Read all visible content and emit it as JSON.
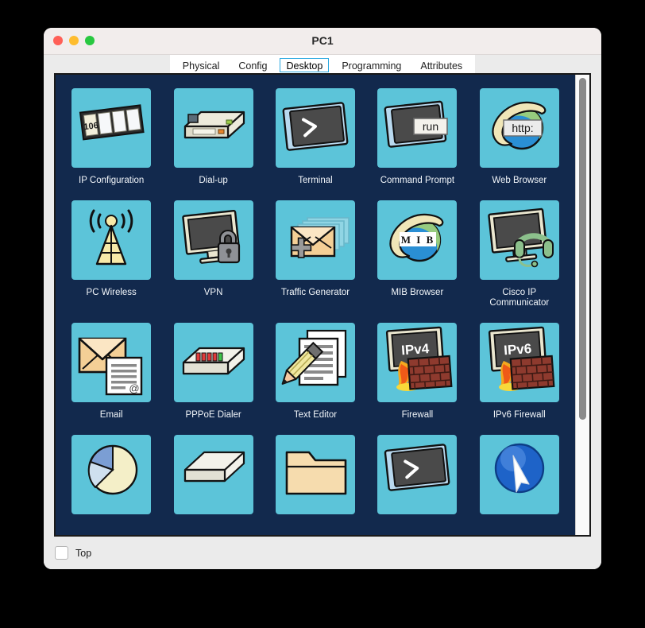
{
  "window": {
    "title": "PC1",
    "controls": [
      {
        "name": "close",
        "color": "#ff5f57"
      },
      {
        "name": "minimize",
        "color": "#febc2e"
      },
      {
        "name": "zoom",
        "color": "#28c840"
      }
    ]
  },
  "tabs": [
    {
      "label": "Physical",
      "active": false
    },
    {
      "label": "Config",
      "active": false
    },
    {
      "label": "Desktop",
      "active": true
    },
    {
      "label": "Programming",
      "active": false
    },
    {
      "label": "Attributes",
      "active": false
    }
  ],
  "desktop": {
    "background_color": "#12294d",
    "tile_color": "#5cc4d9",
    "items": [
      {
        "label": "IP Configuration",
        "icon": "ip-configuration-icon",
        "badge": "106"
      },
      {
        "label": "Dial-up",
        "icon": "dial-up-icon",
        "badge": ""
      },
      {
        "label": "Terminal",
        "icon": "terminal-icon",
        "badge": ">"
      },
      {
        "label": "Command Prompt",
        "icon": "command-prompt-icon",
        "badge": "run"
      },
      {
        "label": "Web Browser",
        "icon": "web-browser-icon",
        "badge": "http:"
      },
      {
        "label": "PC Wireless",
        "icon": "pc-wireless-icon",
        "badge": ""
      },
      {
        "label": "VPN",
        "icon": "vpn-icon",
        "badge": ""
      },
      {
        "label": "Traffic Generator",
        "icon": "traffic-generator-icon",
        "badge": ""
      },
      {
        "label": "MIB Browser",
        "icon": "mib-browser-icon",
        "badge": "M I B"
      },
      {
        "label": "Cisco IP Communicator",
        "icon": "cisco-ip-communicator-icon",
        "badge": ""
      },
      {
        "label": "Email",
        "icon": "email-icon",
        "badge": "@"
      },
      {
        "label": "PPPoE Dialer",
        "icon": "pppoe-dialer-icon",
        "badge": ""
      },
      {
        "label": "Text Editor",
        "icon": "text-editor-icon",
        "badge": ""
      },
      {
        "label": "Firewall",
        "icon": "firewall-icon",
        "badge": "IPv4"
      },
      {
        "label": "IPv6 Firewall",
        "icon": "ipv6-firewall-icon",
        "badge": "IPv6"
      },
      {
        "label": "",
        "icon": "pie-chart-icon",
        "badge": ""
      },
      {
        "label": "",
        "icon": "device-box-icon",
        "badge": ""
      },
      {
        "label": "",
        "icon": "folder-icon",
        "badge": ""
      },
      {
        "label": "",
        "icon": "terminal-partial-icon",
        "badge": ">"
      },
      {
        "label": "",
        "icon": "cursor-circle-icon",
        "badge": ""
      }
    ]
  },
  "footer": {
    "checkbox_label": "Top",
    "checkbox_checked": false
  }
}
